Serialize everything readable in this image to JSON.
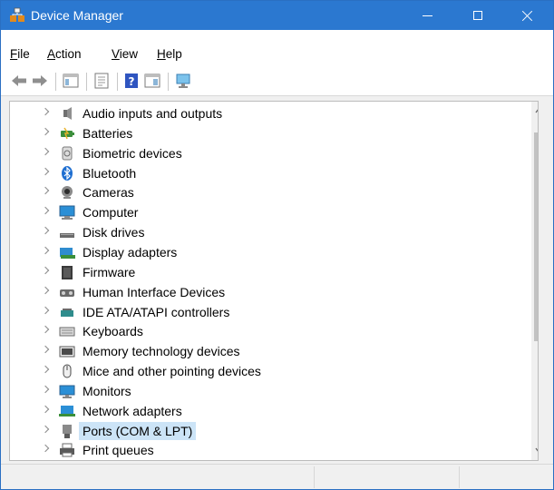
{
  "window": {
    "title": "Device Manager"
  },
  "menu": [
    "File",
    "Action",
    "View",
    "Help"
  ],
  "devices": [
    {
      "label": "Audio inputs and outputs",
      "icon": "speaker-icon"
    },
    {
      "label": "Batteries",
      "icon": "battery-icon"
    },
    {
      "label": "Biometric devices",
      "icon": "fingerprint-icon"
    },
    {
      "label": "Bluetooth",
      "icon": "bluetooth-icon"
    },
    {
      "label": "Cameras",
      "icon": "camera-icon"
    },
    {
      "label": "Computer",
      "icon": "computer-icon"
    },
    {
      "label": "Disk drives",
      "icon": "disk-drive-icon"
    },
    {
      "label": "Display adapters",
      "icon": "display-adapter-icon"
    },
    {
      "label": "Firmware",
      "icon": "firmware-icon"
    },
    {
      "label": "Human Interface Devices",
      "icon": "hid-icon"
    },
    {
      "label": "IDE ATA/ATAPI controllers",
      "icon": "ide-controller-icon"
    },
    {
      "label": "Keyboards",
      "icon": "keyboard-icon"
    },
    {
      "label": "Memory technology devices",
      "icon": "memory-icon"
    },
    {
      "label": "Mice and other pointing devices",
      "icon": "mouse-icon"
    },
    {
      "label": "Monitors",
      "icon": "monitor-icon"
    },
    {
      "label": "Network adapters",
      "icon": "network-adapter-icon"
    },
    {
      "label": "Ports (COM & LPT)",
      "icon": "port-icon",
      "selected": true
    },
    {
      "label": "Print queues",
      "icon": "printer-icon"
    }
  ],
  "colors": {
    "titlebar": "#2b78d0",
    "selection": "#cce4f7"
  }
}
